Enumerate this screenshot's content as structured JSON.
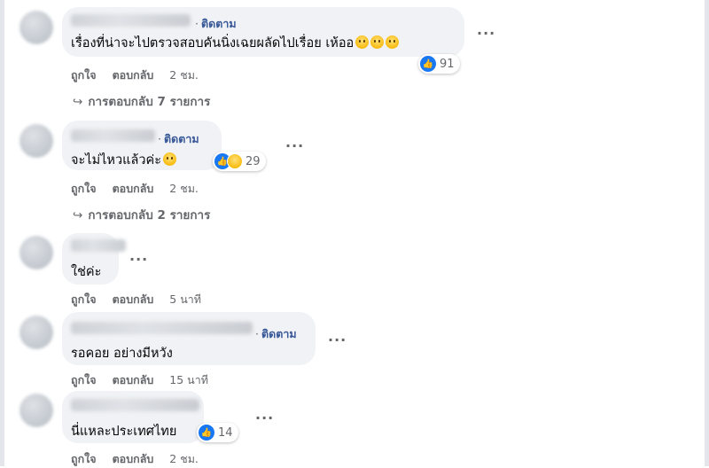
{
  "comments": [
    {
      "follow": "ติดตาม",
      "text": "เรื่องที่น่าจะไปตรวจสอบคันนิ่งเฉยผลัดไปเรื่อย เห้ออ",
      "reaction_count": "91",
      "like_label": "ถูกใจ",
      "reply_label": "ตอบกลับ",
      "time": "2 ชม.",
      "view_replies": "การตอบกลับ 7 รายการ"
    },
    {
      "follow": "ติดตาม",
      "text": "จะไม่ไหวแล้วค่ะ",
      "reaction_count": "29",
      "like_label": "ถูกใจ",
      "reply_label": "ตอบกลับ",
      "time": "2 ชม.",
      "view_replies": "การตอบกลับ 2 รายการ"
    },
    {
      "text": "ใช่ค่ะ",
      "like_label": "ถูกใจ",
      "reply_label": "ตอบกลับ",
      "time": "5 นาที"
    },
    {
      "follow": "ติดตาม",
      "text": "รอคอย อย่างมีหวัง",
      "like_label": "ถูกใจ",
      "reply_label": "ตอบกลับ",
      "time": "15 นาที"
    },
    {
      "text": "นี่แหละประเทศไทย",
      "reaction_count": "14",
      "like_label": "ถูกใจ",
      "reply_label": "ตอบกลับ",
      "time": "2 ชม."
    }
  ],
  "more_glyph": "···",
  "reply_arrow": "↪",
  "colors": {
    "bubble": "#f0f2f5",
    "link": "#385898",
    "meta": "#65676b",
    "like": "#1877f2"
  },
  "icons": [
    "like-icon",
    "sad-icon",
    "emoji-icon",
    "more-icon",
    "reply-arrow-icon"
  ]
}
